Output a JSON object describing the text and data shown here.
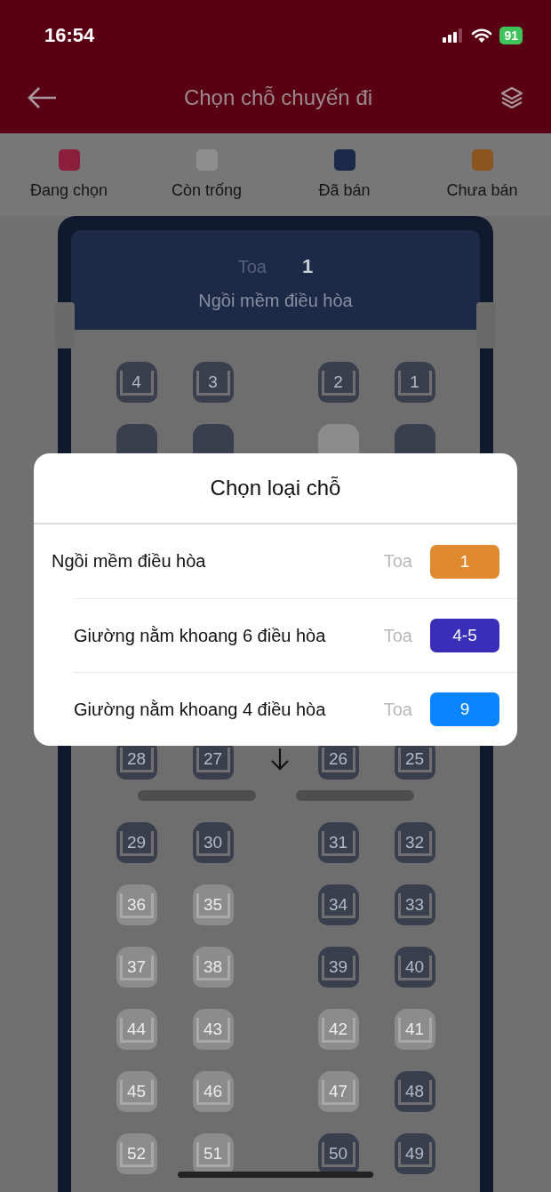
{
  "status_bar": {
    "time": "16:54",
    "battery": "91"
  },
  "header": {
    "title": "Chọn chỗ chuyến đi"
  },
  "legend": [
    {
      "label": "Đang chọn",
      "color": "#8a1e3c"
    },
    {
      "label": "Còn trống",
      "color": "#8e8e8e"
    },
    {
      "label": "Đã bán",
      "color": "#1c2a4a"
    },
    {
      "label": "Chưa bán",
      "color": "#8a5520"
    }
  ],
  "car": {
    "label": "Toa",
    "number": "1",
    "class_name": "Ngồi mềm điều hòa",
    "rows": [
      {
        "kind": "seats",
        "seats": [
          {
            "number": "4",
            "sold": true
          },
          {
            "number": "3",
            "sold": true
          },
          {
            "number": "2",
            "sold": true
          },
          {
            "number": "1",
            "sold": true
          }
        ]
      },
      {
        "kind": "seats",
        "seats": [
          {
            "sold": true
          },
          {
            "sold": true
          },
          {
            "sold": false
          },
          {
            "sold": true
          }
        ]
      },
      {
        "kind": "gap"
      },
      {
        "kind": "seats",
        "aisle_arrow": true,
        "seats": [
          {
            "number": "28",
            "sold": true
          },
          {
            "number": "27",
            "sold": true
          },
          {
            "number": "26",
            "sold": true
          },
          {
            "number": "25",
            "sold": true
          }
        ]
      },
      {
        "kind": "divider"
      },
      {
        "kind": "seats",
        "seats": [
          {
            "number": "29",
            "sold": true
          },
          {
            "number": "30",
            "sold": true
          },
          {
            "number": "31",
            "sold": true
          },
          {
            "number": "32",
            "sold": true
          }
        ]
      },
      {
        "kind": "seats",
        "seats": [
          {
            "number": "36",
            "sold": false
          },
          {
            "number": "35",
            "sold": false
          },
          {
            "number": "34",
            "sold": true
          },
          {
            "number": "33",
            "sold": true
          }
        ]
      },
      {
        "kind": "seats",
        "seats": [
          {
            "number": "37",
            "sold": false
          },
          {
            "number": "38",
            "sold": false
          },
          {
            "number": "39",
            "sold": true
          },
          {
            "number": "40",
            "sold": true
          }
        ]
      },
      {
        "kind": "seats",
        "seats": [
          {
            "number": "44",
            "sold": false
          },
          {
            "number": "43",
            "sold": false
          },
          {
            "number": "42",
            "sold": false
          },
          {
            "number": "41",
            "sold": false
          }
        ]
      },
      {
        "kind": "seats",
        "seats": [
          {
            "number": "45",
            "sold": false
          },
          {
            "number": "46",
            "sold": false
          },
          {
            "number": "47",
            "sold": false
          },
          {
            "number": "48",
            "sold": true
          }
        ]
      },
      {
        "kind": "seats",
        "seats": [
          {
            "number": "52",
            "sold": false
          },
          {
            "number": "51",
            "sold": false
          },
          {
            "number": "50",
            "sold": true
          },
          {
            "number": "49",
            "sold": true
          }
        ]
      }
    ]
  },
  "modal": {
    "title": "Chọn loại chỗ",
    "options": [
      {
        "name": "Ngồi mềm điều hòa",
        "car_label": "Toa",
        "car": "1",
        "color": "#e08a30"
      },
      {
        "name": "Giường nằm khoang 6 điều hòa",
        "car_label": "Toa",
        "car": "4-5",
        "color": "#3a2db8"
      },
      {
        "name": "Giường nằm khoang 4 điều hòa",
        "car_label": "Toa",
        "car": "9",
        "color": "#0a84ff"
      }
    ]
  }
}
